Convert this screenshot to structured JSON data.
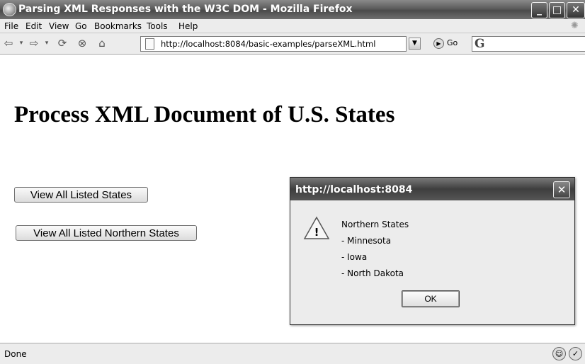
{
  "window": {
    "title": "Parsing XML Responses with the W3C DOM - Mozilla Firefox",
    "controls": {
      "minimize": "_",
      "maximize": "□",
      "close": "✕"
    }
  },
  "menubar": {
    "items": [
      "File",
      "Edit",
      "View",
      "Go",
      "Bookmarks",
      "Tools",
      "Help"
    ]
  },
  "toolbar": {
    "url": "http://localhost:8084/basic-examples/parseXML.html",
    "go_label": "Go",
    "search_logo": "G",
    "icons": [
      "back-icon",
      "forward-icon",
      "reload-icon",
      "stop-icon",
      "home-icon"
    ]
  },
  "page": {
    "heading": "Process XML Document of U.S. States",
    "buttons": {
      "all_states": "View All Listed States",
      "northern_states": "View All Listed Northern States"
    }
  },
  "dialog": {
    "title": "http://localhost:8084",
    "message_lines": [
      "Northern States",
      "- Minnesota",
      "- Iowa",
      "- North Dakota"
    ],
    "ok_label": "OK",
    "icon": "warning-icon"
  },
  "status": {
    "text": "Done"
  }
}
